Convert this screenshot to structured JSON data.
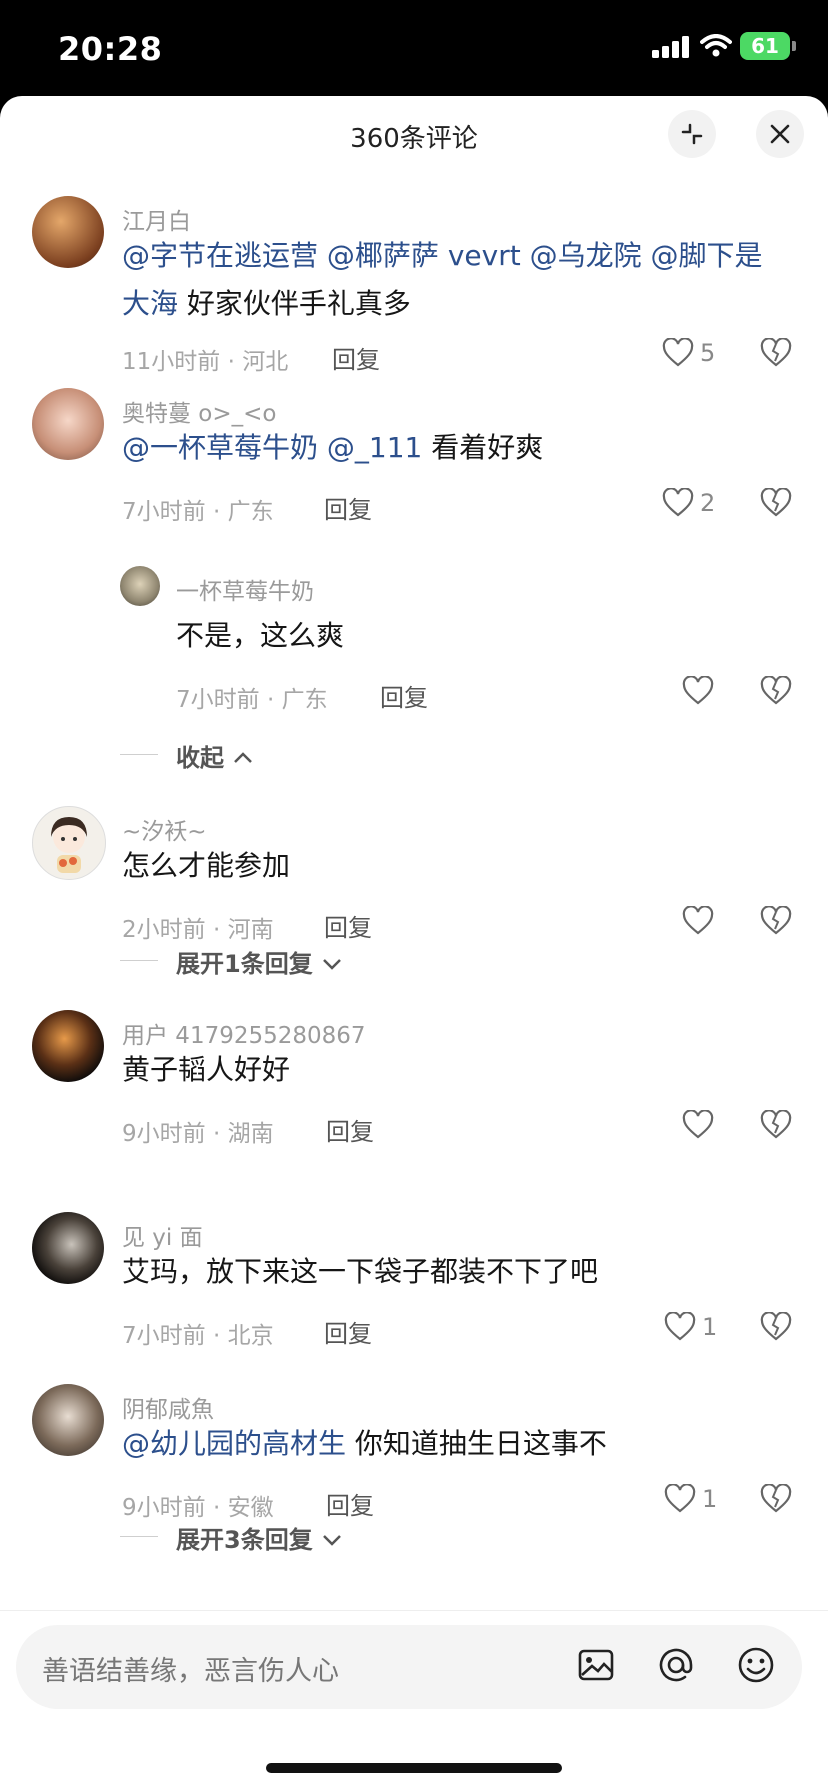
{
  "status": {
    "time": "20:28",
    "battery": "61"
  },
  "header": {
    "title": "360条评论"
  },
  "comments": [
    {
      "user": "江月白",
      "parts": [
        {
          "t": "@字节在逃运营",
          "m": true
        },
        {
          "t": " ",
          "m": false
        },
        {
          "t": "@椰萨萨 vevrt",
          "m": true
        },
        {
          "t": " ",
          "m": false
        },
        {
          "t": "@乌龙院",
          "m": true
        },
        {
          "t": " ",
          "m": false
        },
        {
          "t": "@脚下是大海",
          "m": true
        },
        {
          "t": " 好家伙伴手礼真多",
          "m": false
        }
      ],
      "meta": "11小时前 · 河北",
      "reply": "回复",
      "likes": "5"
    },
    {
      "user": "奥特蔓 o>_<o",
      "parts": [
        {
          "t": "@一杯草莓牛奶",
          "m": true
        },
        {
          "t": " ",
          "m": false
        },
        {
          "t": "@_111",
          "m": true
        },
        {
          "t": " 看着好爽",
          "m": false
        }
      ],
      "meta": "7小时前 · 广东",
      "reply": "回复",
      "likes": "2"
    },
    {
      "user": "一杯草莓牛奶",
      "parts": [
        {
          "t": "不是，这么爽",
          "m": false
        }
      ],
      "meta": "7小时前 · 广东",
      "reply": "回复",
      "likes": ""
    },
    {
      "user": "~汐袄~",
      "parts": [
        {
          "t": "怎么才能参加",
          "m": false
        }
      ],
      "meta": "2小时前 · 河南",
      "reply": "回复",
      "likes": ""
    },
    {
      "user": "用户 4179255280867",
      "parts": [
        {
          "t": "黄子韬人好好",
          "m": false
        }
      ],
      "meta": "9小时前 · 湖南",
      "reply": "回复",
      "likes": ""
    },
    {
      "user": "见 yi 面",
      "parts": [
        {
          "t": "艾玛，放下来这一下袋子都装不下了吧",
          "m": false
        }
      ],
      "meta": "7小时前 · 北京",
      "reply": "回复",
      "likes": "1"
    },
    {
      "user": "阴郁咸魚",
      "parts": [
        {
          "t": "@幼儿园的高材生",
          "m": true
        },
        {
          "t": " 你知道抽生日这事不",
          "m": false
        }
      ],
      "meta": "9小时前 · 安徽",
      "reply": "回复",
      "likes": "1"
    }
  ],
  "toggles": {
    "collapse": "收起",
    "expand1": "展开1条回复",
    "expand3": "展开3条回复"
  },
  "input": {
    "placeholder": "善语结善缘，恶言伤人心"
  },
  "icons": [
    "collapse-icon",
    "close-icon",
    "heart-icon",
    "broken-heart-icon",
    "image-icon",
    "at-icon",
    "emoji-icon"
  ]
}
